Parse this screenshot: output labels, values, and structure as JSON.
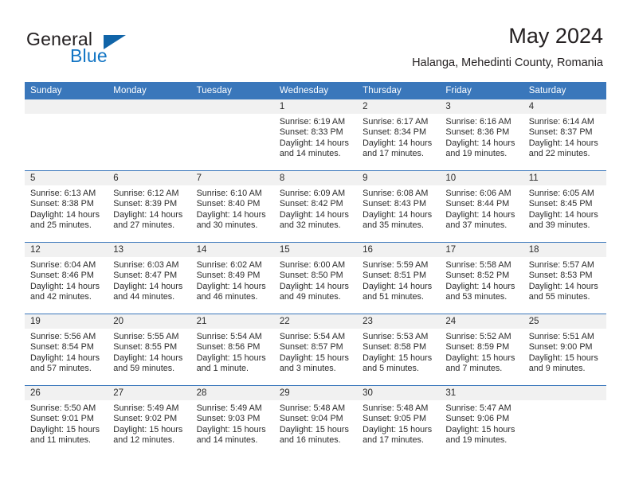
{
  "brand": {
    "name_part1": "General",
    "name_part2": "Blue",
    "triangle_color": "#1064a8",
    "blue_color": "#1275c4"
  },
  "header": {
    "month_title": "May 2024",
    "location": "Halanga, Mehedinti County, Romania"
  },
  "theme": {
    "header_blue": "#3a77bb",
    "daynum_band": "#f1f1f1",
    "text": "#2b2b2b"
  },
  "weekday_headers": [
    "Sunday",
    "Monday",
    "Tuesday",
    "Wednesday",
    "Thursday",
    "Friday",
    "Saturday"
  ],
  "weeks": [
    [
      {
        "day": "",
        "sunrise": "",
        "sunset": "",
        "daylight1": "",
        "daylight2": ""
      },
      {
        "day": "",
        "sunrise": "",
        "sunset": "",
        "daylight1": "",
        "daylight2": ""
      },
      {
        "day": "",
        "sunrise": "",
        "sunset": "",
        "daylight1": "",
        "daylight2": ""
      },
      {
        "day": "1",
        "sunrise": "Sunrise: 6:19 AM",
        "sunset": "Sunset: 8:33 PM",
        "daylight1": "Daylight: 14 hours",
        "daylight2": "and 14 minutes."
      },
      {
        "day": "2",
        "sunrise": "Sunrise: 6:17 AM",
        "sunset": "Sunset: 8:34 PM",
        "daylight1": "Daylight: 14 hours",
        "daylight2": "and 17 minutes."
      },
      {
        "day": "3",
        "sunrise": "Sunrise: 6:16 AM",
        "sunset": "Sunset: 8:36 PM",
        "daylight1": "Daylight: 14 hours",
        "daylight2": "and 19 minutes."
      },
      {
        "day": "4",
        "sunrise": "Sunrise: 6:14 AM",
        "sunset": "Sunset: 8:37 PM",
        "daylight1": "Daylight: 14 hours",
        "daylight2": "and 22 minutes."
      }
    ],
    [
      {
        "day": "5",
        "sunrise": "Sunrise: 6:13 AM",
        "sunset": "Sunset: 8:38 PM",
        "daylight1": "Daylight: 14 hours",
        "daylight2": "and 25 minutes."
      },
      {
        "day": "6",
        "sunrise": "Sunrise: 6:12 AM",
        "sunset": "Sunset: 8:39 PM",
        "daylight1": "Daylight: 14 hours",
        "daylight2": "and 27 minutes."
      },
      {
        "day": "7",
        "sunrise": "Sunrise: 6:10 AM",
        "sunset": "Sunset: 8:40 PM",
        "daylight1": "Daylight: 14 hours",
        "daylight2": "and 30 minutes."
      },
      {
        "day": "8",
        "sunrise": "Sunrise: 6:09 AM",
        "sunset": "Sunset: 8:42 PM",
        "daylight1": "Daylight: 14 hours",
        "daylight2": "and 32 minutes."
      },
      {
        "day": "9",
        "sunrise": "Sunrise: 6:08 AM",
        "sunset": "Sunset: 8:43 PM",
        "daylight1": "Daylight: 14 hours",
        "daylight2": "and 35 minutes."
      },
      {
        "day": "10",
        "sunrise": "Sunrise: 6:06 AM",
        "sunset": "Sunset: 8:44 PM",
        "daylight1": "Daylight: 14 hours",
        "daylight2": "and 37 minutes."
      },
      {
        "day": "11",
        "sunrise": "Sunrise: 6:05 AM",
        "sunset": "Sunset: 8:45 PM",
        "daylight1": "Daylight: 14 hours",
        "daylight2": "and 39 minutes."
      }
    ],
    [
      {
        "day": "12",
        "sunrise": "Sunrise: 6:04 AM",
        "sunset": "Sunset: 8:46 PM",
        "daylight1": "Daylight: 14 hours",
        "daylight2": "and 42 minutes."
      },
      {
        "day": "13",
        "sunrise": "Sunrise: 6:03 AM",
        "sunset": "Sunset: 8:47 PM",
        "daylight1": "Daylight: 14 hours",
        "daylight2": "and 44 minutes."
      },
      {
        "day": "14",
        "sunrise": "Sunrise: 6:02 AM",
        "sunset": "Sunset: 8:49 PM",
        "daylight1": "Daylight: 14 hours",
        "daylight2": "and 46 minutes."
      },
      {
        "day": "15",
        "sunrise": "Sunrise: 6:00 AM",
        "sunset": "Sunset: 8:50 PM",
        "daylight1": "Daylight: 14 hours",
        "daylight2": "and 49 minutes."
      },
      {
        "day": "16",
        "sunrise": "Sunrise: 5:59 AM",
        "sunset": "Sunset: 8:51 PM",
        "daylight1": "Daylight: 14 hours",
        "daylight2": "and 51 minutes."
      },
      {
        "day": "17",
        "sunrise": "Sunrise: 5:58 AM",
        "sunset": "Sunset: 8:52 PM",
        "daylight1": "Daylight: 14 hours",
        "daylight2": "and 53 minutes."
      },
      {
        "day": "18",
        "sunrise": "Sunrise: 5:57 AM",
        "sunset": "Sunset: 8:53 PM",
        "daylight1": "Daylight: 14 hours",
        "daylight2": "and 55 minutes."
      }
    ],
    [
      {
        "day": "19",
        "sunrise": "Sunrise: 5:56 AM",
        "sunset": "Sunset: 8:54 PM",
        "daylight1": "Daylight: 14 hours",
        "daylight2": "and 57 minutes."
      },
      {
        "day": "20",
        "sunrise": "Sunrise: 5:55 AM",
        "sunset": "Sunset: 8:55 PM",
        "daylight1": "Daylight: 14 hours",
        "daylight2": "and 59 minutes."
      },
      {
        "day": "21",
        "sunrise": "Sunrise: 5:54 AM",
        "sunset": "Sunset: 8:56 PM",
        "daylight1": "Daylight: 15 hours",
        "daylight2": "and 1 minute."
      },
      {
        "day": "22",
        "sunrise": "Sunrise: 5:54 AM",
        "sunset": "Sunset: 8:57 PM",
        "daylight1": "Daylight: 15 hours",
        "daylight2": "and 3 minutes."
      },
      {
        "day": "23",
        "sunrise": "Sunrise: 5:53 AM",
        "sunset": "Sunset: 8:58 PM",
        "daylight1": "Daylight: 15 hours",
        "daylight2": "and 5 minutes."
      },
      {
        "day": "24",
        "sunrise": "Sunrise: 5:52 AM",
        "sunset": "Sunset: 8:59 PM",
        "daylight1": "Daylight: 15 hours",
        "daylight2": "and 7 minutes."
      },
      {
        "day": "25",
        "sunrise": "Sunrise: 5:51 AM",
        "sunset": "Sunset: 9:00 PM",
        "daylight1": "Daylight: 15 hours",
        "daylight2": "and 9 minutes."
      }
    ],
    [
      {
        "day": "26",
        "sunrise": "Sunrise: 5:50 AM",
        "sunset": "Sunset: 9:01 PM",
        "daylight1": "Daylight: 15 hours",
        "daylight2": "and 11 minutes."
      },
      {
        "day": "27",
        "sunrise": "Sunrise: 5:49 AM",
        "sunset": "Sunset: 9:02 PM",
        "daylight1": "Daylight: 15 hours",
        "daylight2": "and 12 minutes."
      },
      {
        "day": "28",
        "sunrise": "Sunrise: 5:49 AM",
        "sunset": "Sunset: 9:03 PM",
        "daylight1": "Daylight: 15 hours",
        "daylight2": "and 14 minutes."
      },
      {
        "day": "29",
        "sunrise": "Sunrise: 5:48 AM",
        "sunset": "Sunset: 9:04 PM",
        "daylight1": "Daylight: 15 hours",
        "daylight2": "and 16 minutes."
      },
      {
        "day": "30",
        "sunrise": "Sunrise: 5:48 AM",
        "sunset": "Sunset: 9:05 PM",
        "daylight1": "Daylight: 15 hours",
        "daylight2": "and 17 minutes."
      },
      {
        "day": "31",
        "sunrise": "Sunrise: 5:47 AM",
        "sunset": "Sunset: 9:06 PM",
        "daylight1": "Daylight: 15 hours",
        "daylight2": "and 19 minutes."
      },
      {
        "day": "",
        "sunrise": "",
        "sunset": "",
        "daylight1": "",
        "daylight2": ""
      }
    ]
  ]
}
